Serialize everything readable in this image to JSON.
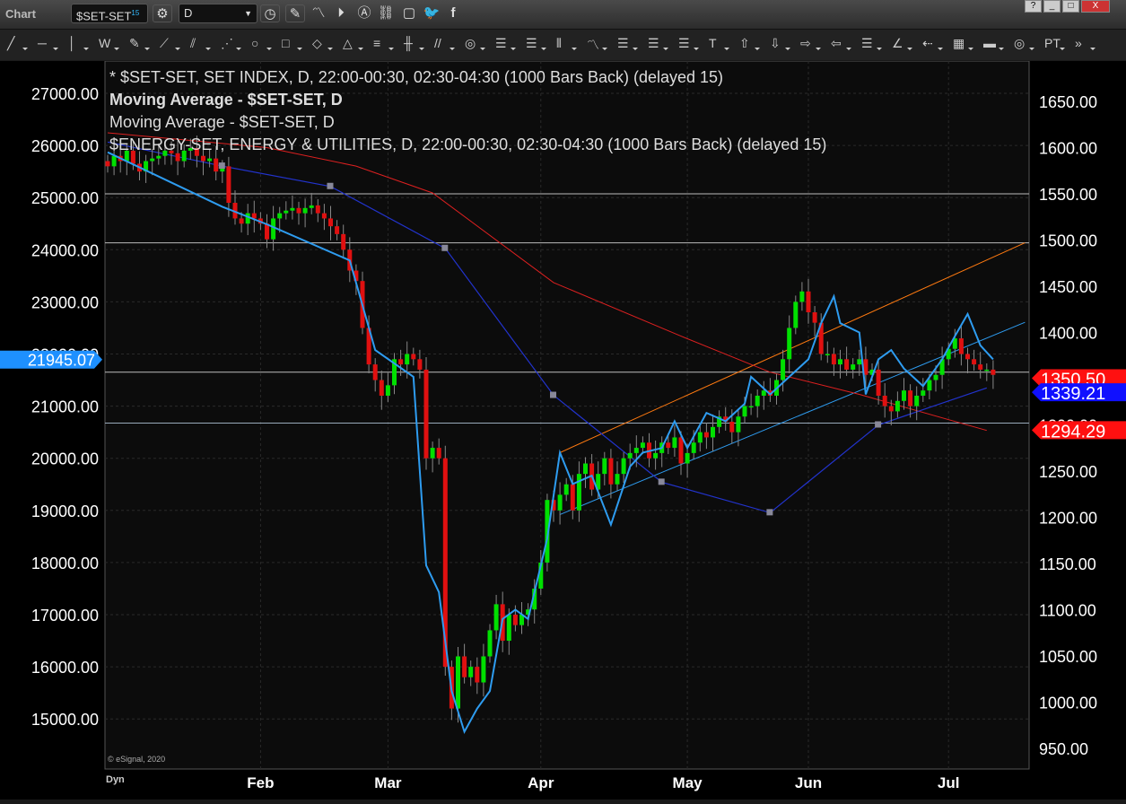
{
  "window": {
    "title": "Chart",
    "controls": [
      "?",
      "_",
      "□",
      "X"
    ]
  },
  "toolbar": {
    "symbol": "$SET-SET",
    "symbol_sup": "15",
    "interval": "D",
    "icons": [
      "gear-icon",
      "clock-icon",
      "pencil-icon",
      "study-icon",
      "play-icon",
      "alert-icon",
      "link-icon",
      "chat-icon",
      "twitter-icon",
      "facebook-icon"
    ]
  },
  "drawing_tools": [
    "╱",
    "─",
    "│",
    "W",
    "✎",
    "⟋",
    "⫽",
    "⋰",
    "○",
    "□",
    "◇",
    "△",
    "≡",
    "╫",
    "//",
    "◎",
    "☰",
    "☰",
    "⫴",
    "〽",
    "☰",
    "☰",
    "☰",
    "T",
    "⇧",
    "⇩",
    "⇨",
    "⇦",
    "☰",
    "∠",
    "⇠",
    "▦",
    "▬",
    "◎",
    "PT",
    "»"
  ],
  "legend": [
    "* $SET-SET, SET INDEX, D, 22:00-00:30, 02:30-04:30 (1000 Bars Back) (delayed 15)",
    "Moving Average - $SET-SET, D",
    "Moving Average - $SET-SET, D",
    "$ENERGY-SET, ENERGY & UTILITIES, D, 22:00-00:30, 02:30-04:30 (1000 Bars Back) (delayed 15)"
  ],
  "left_axis": {
    "ticks": [
      "27000.00",
      "26000.00",
      "25000.00",
      "24000.00",
      "23000.00",
      "22000.00",
      "21000.00",
      "20000.00",
      "19000.00",
      "18000.00",
      "17000.00",
      "16000.00",
      "15000.00"
    ],
    "current": "21945.07"
  },
  "right_axis": {
    "ticks": [
      "1650.00",
      "1600.00",
      "1550.00",
      "1500.00",
      "1450.00",
      "1400.00",
      "1350.00",
      "1300.00",
      "1250.00",
      "1200.00",
      "1150.00",
      "1100.00",
      "1050.00",
      "1000.00",
      "950.00"
    ],
    "labels": [
      {
        "text": "1350.50",
        "value": 1350.5,
        "color": "#ff1010"
      },
      {
        "text": "1339.21",
        "value": 1339.21,
        "color": "#1010ff"
      },
      {
        "text": "1294.29",
        "value": 1294.29,
        "color": "#ff1010"
      }
    ]
  },
  "x_axis": {
    "months": [
      {
        "label": "Feb",
        "bar": 24
      },
      {
        "label": "Mar",
        "bar": 44
      },
      {
        "label": "Apr",
        "bar": 68
      },
      {
        "label": "May",
        "bar": 91
      },
      {
        "label": "Jun",
        "bar": 110
      },
      {
        "label": "Jul",
        "bar": 132
      }
    ],
    "dyn": "Dyn"
  },
  "copyright": "© eSignal, 2020",
  "chart_data": {
    "type": "candlestick",
    "set_closes": [
      25600,
      25800,
      25700,
      25900,
      25650,
      25500,
      25700,
      25750,
      25800,
      25900,
      25850,
      25700,
      25900,
      25950,
      25800,
      25700,
      25750,
      25500,
      25600,
      24900,
      24600,
      24500,
      24700,
      24600,
      24500,
      24200,
      24600,
      24700,
      24750,
      24800,
      24700,
      24800,
      24850,
      24700,
      24600,
      24450,
      24300,
      24000,
      23600,
      23400,
      22500,
      21800,
      21500,
      21200,
      21400,
      21900,
      21800,
      22000,
      21900,
      21700,
      20000,
      20200,
      20000,
      16000,
      15200,
      16200,
      15800,
      16000,
      15700,
      16200,
      16700,
      17200,
      16500,
      17000,
      16800,
      17000,
      17100,
      17500,
      18000,
      19200,
      19000,
      19300,
      19500,
      19000,
      19700,
      19900,
      19400,
      19700,
      20000,
      19500,
      19700,
      20000,
      20100,
      20200,
      20300,
      20000,
      20100,
      20300,
      20200,
      20400,
      19900,
      20100,
      20300,
      20500,
      20400,
      20600,
      20800,
      20700,
      20500,
      20800,
      21000,
      21000,
      21200,
      21300,
      21200,
      21500,
      21900,
      22500,
      23000,
      23200,
      22800,
      22600,
      22000,
      22000,
      21800,
      21900,
      21700,
      21800,
      21900,
      21600,
      21700,
      21200,
      21000,
      20900,
      21100,
      21300,
      21000,
      21200,
      21300,
      21500,
      21600,
      21900,
      22100,
      22300,
      22000,
      21900,
      21800,
      21700,
      21700,
      21600
    ],
    "energy_line": [
      [
        0,
        1595
      ],
      [
        18,
        1536
      ],
      [
        25,
        1517
      ],
      [
        38,
        1478
      ],
      [
        42,
        1381
      ],
      [
        48,
        1352
      ],
      [
        50,
        1148
      ],
      [
        52,
        1119
      ],
      [
        54,
        1012
      ],
      [
        56,
        968
      ],
      [
        58,
        993
      ],
      [
        60,
        1012
      ],
      [
        62,
        1090
      ],
      [
        64,
        1100
      ],
      [
        66,
        1090
      ],
      [
        69,
        1177
      ],
      [
        71,
        1270
      ],
      [
        73,
        1236
      ],
      [
        76,
        1245
      ],
      [
        79,
        1192
      ],
      [
        82,
        1255
      ],
      [
        84,
        1270
      ],
      [
        87,
        1275
      ],
      [
        89,
        1304
      ],
      [
        91,
        1275
      ],
      [
        94,
        1313
      ],
      [
        97,
        1304
      ],
      [
        100,
        1323
      ],
      [
        101,
        1352
      ],
      [
        104,
        1333
      ],
      [
        107,
        1352
      ],
      [
        110,
        1371
      ],
      [
        112,
        1410
      ],
      [
        114,
        1439
      ],
      [
        115,
        1410
      ],
      [
        118,
        1400
      ],
      [
        119,
        1333
      ],
      [
        121,
        1371
      ],
      [
        123,
        1381
      ],
      [
        125,
        1361
      ],
      [
        128,
        1342
      ],
      [
        131,
        1371
      ],
      [
        133,
        1396
      ],
      [
        135,
        1420
      ],
      [
        137,
        1386
      ],
      [
        139,
        1371
      ]
    ],
    "ma_blue": [
      [
        0,
        1606
      ],
      [
        18,
        1580
      ],
      [
        35,
        1558
      ],
      [
        53,
        1491
      ],
      [
        70,
        1332
      ],
      [
        87,
        1238
      ],
      [
        104,
        1205
      ],
      [
        121,
        1300
      ],
      [
        138,
        1340
      ]
    ],
    "ma_red": [
      [
        0,
        1616
      ],
      [
        25,
        1600
      ],
      [
        39,
        1580
      ],
      [
        51,
        1551
      ],
      [
        70,
        1454
      ],
      [
        90,
        1396
      ],
      [
        104,
        1357
      ],
      [
        118,
        1333
      ],
      [
        138,
        1294
      ]
    ],
    "ma_markers": [
      18,
      35,
      53,
      70,
      87,
      104,
      121
    ],
    "hlines": [
      1550,
      1497,
      1357,
      1302
    ],
    "trend_orange": [
      [
        71,
        1270
      ],
      [
        144,
        1497
      ]
    ],
    "trend_blue": [
      [
        71,
        1203
      ],
      [
        144,
        1411
      ]
    ],
    "left_range": [
      15000,
      27000
    ],
    "right_range": [
      950,
      1650
    ]
  },
  "colors": {
    "up": "#00e000",
    "down": "#e01010",
    "energy": "#2e9cf0",
    "ma_blue": "#2233cc",
    "ma_red": "#dd2020",
    "orange": "#ff7a10"
  }
}
